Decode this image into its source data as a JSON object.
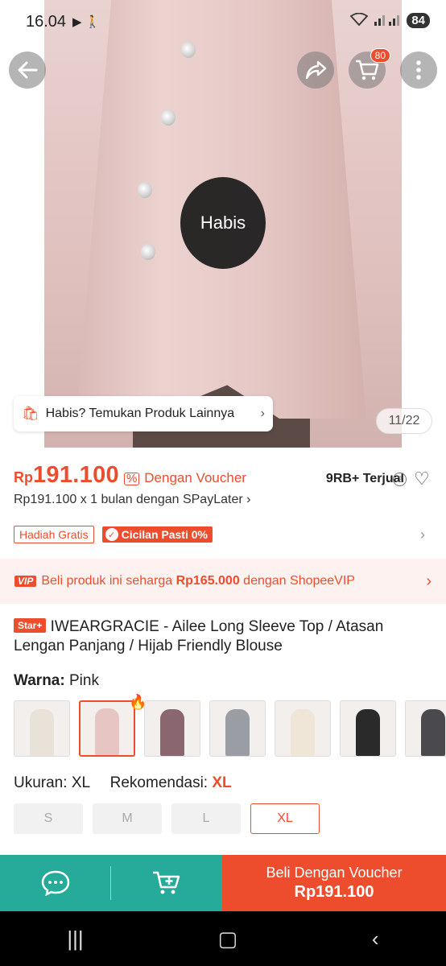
{
  "status": {
    "time": "16.04",
    "icons": "▶ 🚶",
    "battery": "84"
  },
  "header": {
    "cart_count": "80"
  },
  "hero": {
    "sold_out_label": "Habis",
    "sold_out_link": "Habis? Temukan Produk Lainnya",
    "image_counter": "11/22"
  },
  "price": {
    "currency": "Rp",
    "value": "191.100",
    "voucher_label": "Dengan Voucher",
    "sold": "9RB+ Terjual",
    "paylater": "Rp191.100 x 1 bulan dengan SPayLater"
  },
  "tags": {
    "gift": "Hadiah Gratis",
    "cicilan": "Cicilan Pasti 0%"
  },
  "vip": {
    "logo": "VIP",
    "text_before": "Beli produk ini seharga ",
    "price": "Rp165.000",
    "text_after": " dengan ShopeeVIP"
  },
  "product": {
    "badge": "Star+",
    "title": "IWEARGRACIE - Ailee Long Sleeve Top / Atasan Lengan Panjang / Hijab Friendly Blouse"
  },
  "color": {
    "label": "Warna:",
    "value": "Pink",
    "variants": [
      {
        "name": "Cream",
        "color": "#e8e2d8"
      },
      {
        "name": "Pink",
        "color": "#e6c5c2"
      },
      {
        "name": "Mauve",
        "color": "#8a6670"
      },
      {
        "name": "Grey",
        "color": "#9a9ea4"
      },
      {
        "name": "Ivory",
        "color": "#efe6d8"
      },
      {
        "name": "Black",
        "color": "#2a2a2a"
      },
      {
        "name": "Charcoal",
        "color": "#4a4a4e"
      }
    ]
  },
  "size": {
    "label": "Ukuran:",
    "value": "XL",
    "recommend_label": "Rekomendasi:",
    "recommend_value": "XL",
    "options": [
      "S",
      "M",
      "L",
      "XL"
    ]
  },
  "bottom": {
    "buy_line1": "Beli Dengan Voucher",
    "buy_line2": "Rp191.100"
  }
}
